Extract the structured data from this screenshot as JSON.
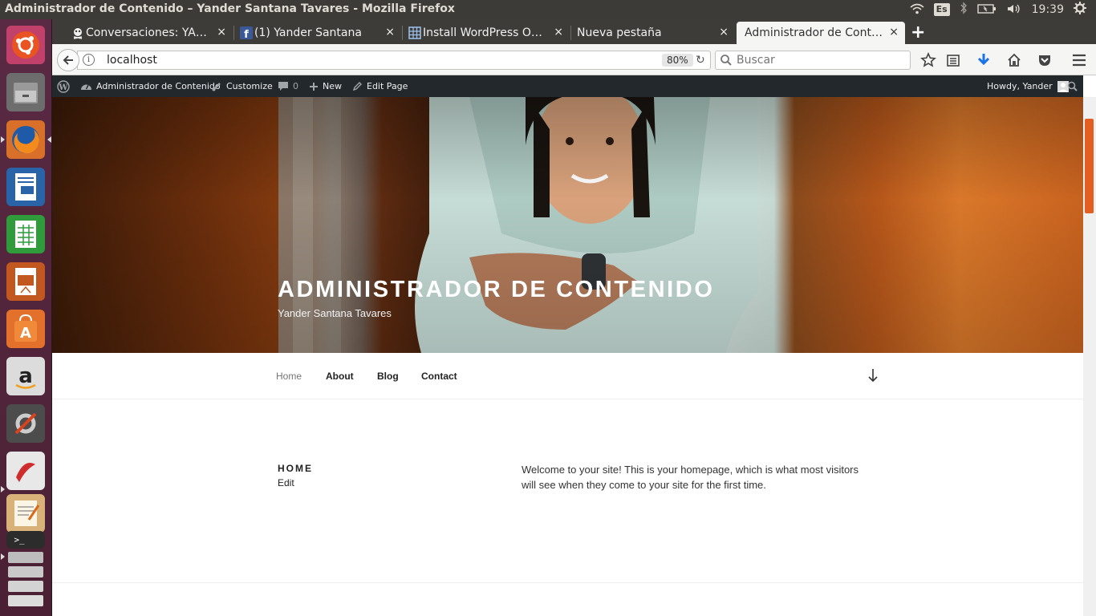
{
  "panel": {
    "window_title": "Administrador de Contenido – Yander Santana Tavares - Mozilla Firefox",
    "keyboard": "Es",
    "clock": "19:39"
  },
  "launcher": {
    "items": [
      "ubuntu-dash-icon",
      "files-icon",
      "firefox-icon",
      "writer-icon",
      "calc-icon",
      "impress-icon",
      "software-center-icon",
      "amazon-icon",
      "system-settings-icon",
      "document-viewer-icon",
      "text-editor-icon",
      "terminal-icon",
      "workspaces-icon"
    ]
  },
  "tabs": [
    {
      "title": "Conversaciones: YA…",
      "close": "×",
      "icon": "pirate-favicon"
    },
    {
      "title": "(1) Yander Santana",
      "close": "×",
      "icon": "facebook-favicon"
    },
    {
      "title": "Install WordPress O…",
      "close": "×",
      "icon": "grid-favicon"
    },
    {
      "title": "Nueva pestaña",
      "close": "×",
      "icon": ""
    },
    {
      "title": "Administrador de Cont…",
      "close": "×",
      "icon": ""
    }
  ],
  "newtab": "+",
  "navbar": {
    "url": "localhost",
    "zoom": "80%",
    "search_placeholder": "Buscar"
  },
  "adminbar": {
    "site": "Administrador de Contenido",
    "customize": "Customize",
    "comments": "0",
    "new": "New",
    "edit_page": "Edit Page",
    "howdy": "Howdy, Yander"
  },
  "site": {
    "title": "ADMINISTRADOR DE CONTENIDO",
    "description": "Yander Santana Tavares"
  },
  "menu": {
    "items": [
      "Home",
      "About",
      "Blog",
      "Contact"
    ]
  },
  "entry": {
    "title": "HOME",
    "edit": "Edit",
    "content": "Welcome to your site! This is your homepage, which is what most visitors will see when they come to your site for the first time."
  },
  "colors": {
    "admin_bar": "#23282d",
    "ubuntu_panel": "#3c3b37",
    "launcher": "#4b2034",
    "scroll_thumb": "#e35e20"
  }
}
